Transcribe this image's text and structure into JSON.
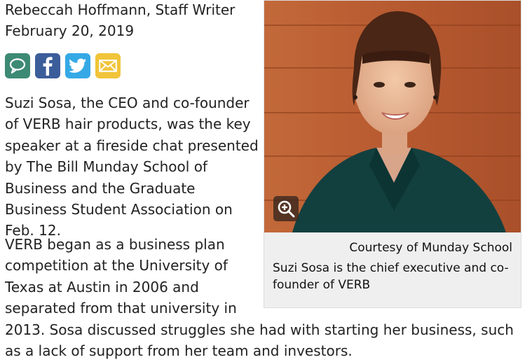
{
  "article": {
    "byline": "Rebeccah Hoffmann, Staff Writer",
    "date": "February 20, 2019",
    "paragraphs": [
      "Suzi Sosa, the CEO and co-founder of VERB hair products, was the key speaker at a fireside chat presented by The Bill Munday School of Business and the Graduate Business Student Association on Feb. 12.",
      "VERB began as a business plan competition at the University of Texas at Austin in 2006 and separated from that university in",
      "2013. Sosa discussed struggles she had with starting her business, such as a lack of support from her team and investors."
    ]
  },
  "share": {
    "icons": [
      "comment-icon",
      "facebook-icon",
      "twitter-icon",
      "email-icon"
    ],
    "colors": {
      "comment": "#3d8a74",
      "facebook": "#3b5d9a",
      "twitter": "#35a9e6",
      "email": "#f1c43a"
    }
  },
  "figure": {
    "credit": "Courtesy of Munday School",
    "caption": "Suzi Sosa is the chief executive and co-founder of VERB",
    "zoom_icon": "zoom-in-icon"
  }
}
